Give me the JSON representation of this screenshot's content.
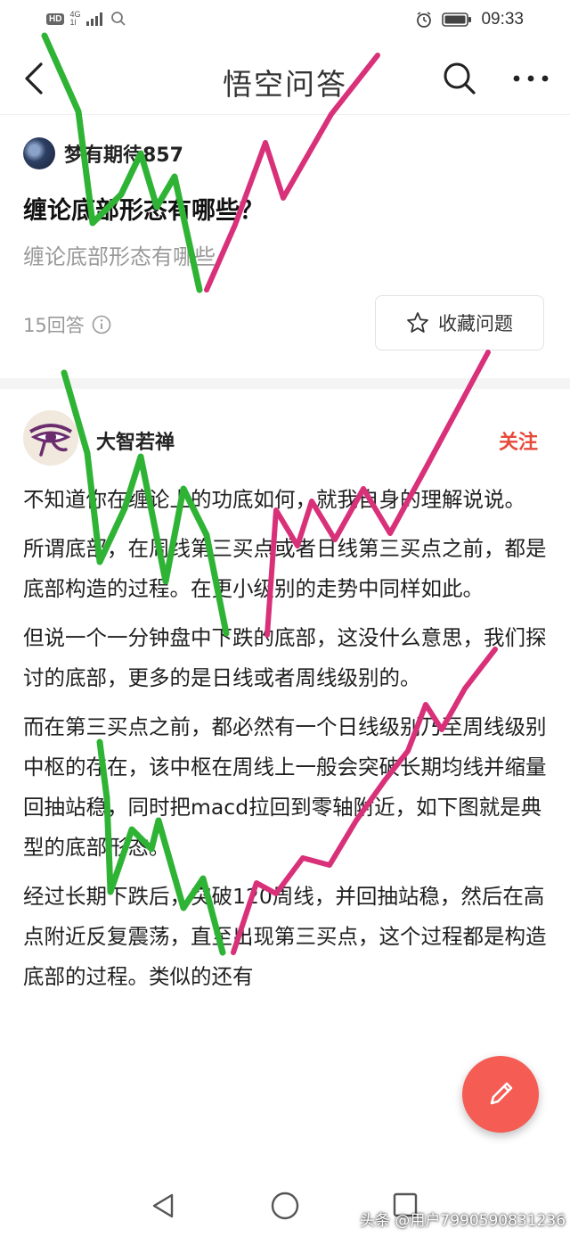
{
  "status_bar": {
    "hd": "HD",
    "network_top": "4G",
    "network_bottom": "1l",
    "time": "09:33"
  },
  "nav": {
    "title": "悟空问答",
    "icons": [
      "back-arrow-icon",
      "search-icon",
      "more-icon"
    ]
  },
  "question": {
    "author": "梦有期待857",
    "title": "缠论底部形态有哪些？",
    "description": "缠论底部形态有哪些",
    "answer_count": "15回答",
    "favorite_label": "收藏问题"
  },
  "answer": {
    "author": "大智若禅",
    "follow_label": "关注",
    "paragraphs": [
      "不知道你在缠论上的功底如何，就我自身的理解说说。",
      "所谓底部，在周线第三买点或者日线第三买点之前，都是底部构造的过程。在更小级别的走势中同样如此。",
      "但说一个一分钟盘中下跌的底部，这没什么意思，我们探讨的底部，更多的是日线或者周线级别的。",
      "而在第三买点之前，都必然有一个日线级别乃至周线级别中枢的存在，该中枢在周线上一般会突破长期均线并缩量回抽站稳，同时把macd拉回到零轴附近，如下图就是典型的底部形态。",
      "经过长期下跌后，突破120周线，并回抽站稳，然后在高点附近反复震荡，直至出现第三买点，这个过程都是构造底部的过程。类似的还有"
    ]
  },
  "watermark": "头条 @用户7990590831236",
  "colors": {
    "accent_red": "#e64a3b",
    "fab": "#f45c54",
    "overlay_green": "#2fb335",
    "overlay_pink": "#d8317a"
  }
}
